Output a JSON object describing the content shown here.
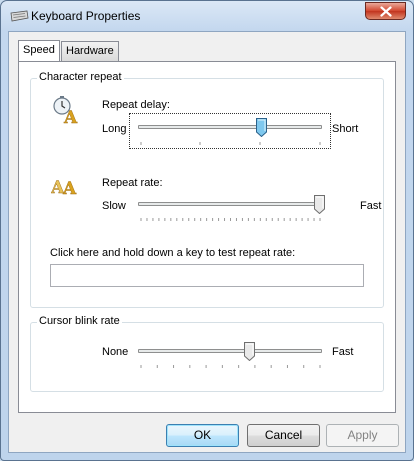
{
  "window": {
    "title": "Keyboard Properties"
  },
  "tabs": [
    {
      "label": "Speed",
      "active": true
    },
    {
      "label": "Hardware",
      "active": false
    }
  ],
  "character_repeat": {
    "legend": "Character repeat",
    "repeat_delay": {
      "label": "Repeat delay:",
      "min_label": "Long",
      "max_label": "Short",
      "value_fraction": 0.67
    },
    "repeat_rate": {
      "label": "Repeat rate:",
      "min_label": "Slow",
      "max_label": "Fast",
      "value_fraction": 1.0
    },
    "test_prompt": "Click here and hold down a key to test repeat rate:",
    "test_value": ""
  },
  "cursor_blink": {
    "legend": "Cursor blink rate",
    "min_label": "None",
    "max_label": "Fast",
    "value_fraction": 0.6
  },
  "buttons": {
    "ok": "OK",
    "cancel": "Cancel",
    "apply": "Apply"
  },
  "icons": {
    "title": "keyboard-icon",
    "delay": "clock-letter-a-icon",
    "rate": "double-letter-a-icon",
    "close": "close-icon"
  }
}
